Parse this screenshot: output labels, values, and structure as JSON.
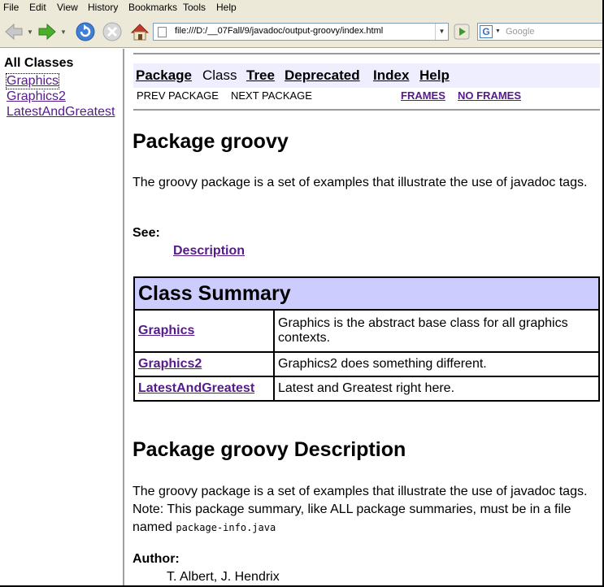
{
  "menu": [
    "File",
    "Edit",
    "View",
    "History",
    "Bookmarks",
    "Tools",
    "Help"
  ],
  "toolbar": {
    "url": "file:///D:/__07Fall/9/javadoc/output-groovy/index.html",
    "search_placeholder": "Google",
    "search_engine_letter": "G",
    "icons": [
      "back-icon",
      "forward-icon",
      "reload-icon",
      "stop-icon",
      "home-icon",
      "go-icon"
    ]
  },
  "left_frame": {
    "title": "All Classes",
    "classes": [
      "Graphics",
      "Graphics2",
      "LatestAndGreatest"
    ]
  },
  "nav": {
    "items": [
      {
        "label": "Package",
        "current": false
      },
      {
        "label": "Class",
        "current": true
      },
      {
        "label": "Tree",
        "current": false
      },
      {
        "label": "Deprecated",
        "current": false
      },
      {
        "label": "Index",
        "current": false
      },
      {
        "label": "Help",
        "current": false
      }
    ],
    "prev": "PREV PACKAGE",
    "next": "NEXT PACKAGE",
    "frames": "FRAMES",
    "no_frames": "NO FRAMES"
  },
  "content": {
    "title": "Package groovy",
    "intro": "The groovy package is a set of examples that illustrate the use of javadoc tags.",
    "see_label": "See:",
    "see_link": "Description",
    "summary_title": "Class Summary",
    "summary_rows": [
      {
        "name": "Graphics",
        "desc": "Graphics is the abstract base class for all graphics contexts."
      },
      {
        "name": "Graphics2",
        "desc": "Graphics2 does something different."
      },
      {
        "name": "LatestAndGreatest",
        "desc": "Latest and Greatest right here."
      }
    ],
    "desc_title": "Package groovy Description",
    "desc_text": "The groovy package is a set of examples that illustrate the use of javadoc tags. Note: This package summary, like ALL package summaries, must be in a file named",
    "desc_code": "package-info.java",
    "author_label": "Author:",
    "author_value": "T. Albert, J. Hendrix"
  },
  "colors": {
    "link_visited": "#551a8b",
    "nav_bg": "#eeeeff",
    "table_header_bg": "#ccccff",
    "chrome_bg": "#ece9d8"
  }
}
